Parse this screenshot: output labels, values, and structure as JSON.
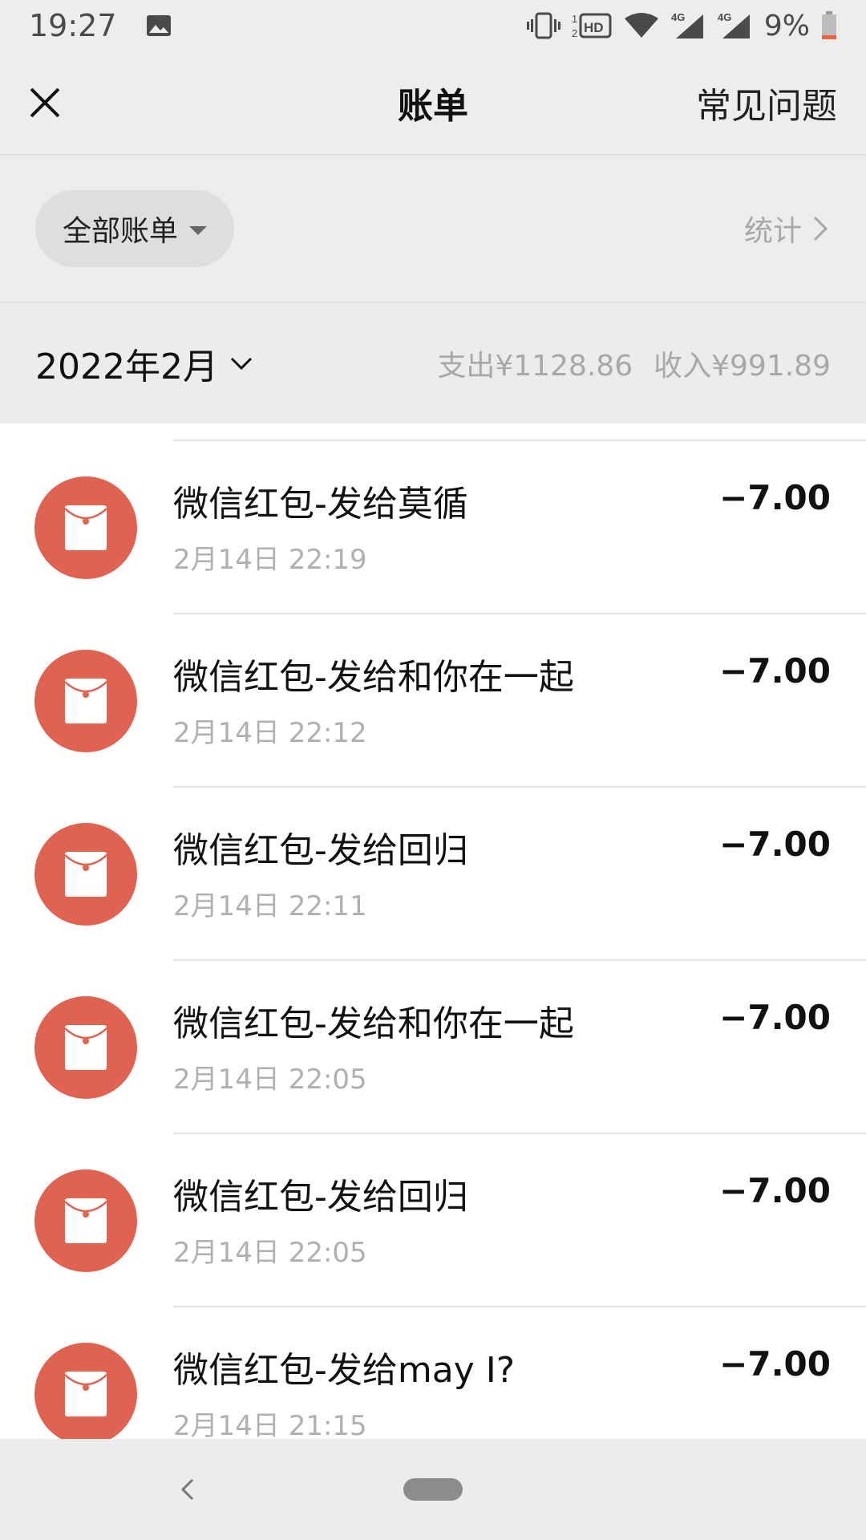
{
  "status_bar": {
    "time": "19:27",
    "icons": [
      "image-icon",
      "vibrate-icon",
      "hd-icon",
      "wifi-icon",
      "signal-4g-icon",
      "signal-4g-icon",
      "battery-icon"
    ],
    "net_label_1": "4G",
    "net_label_2": "4G",
    "battery": "9%"
  },
  "nav": {
    "title": "账单",
    "faq_label": "常见问题"
  },
  "filter": {
    "selected": "全部账单",
    "stats_label": "统计"
  },
  "month": {
    "label": "2022年2月",
    "expense": "支出¥1128.86",
    "income": "收入¥991.89"
  },
  "colors": {
    "accent": "#e06351",
    "background": "#ededed",
    "list_background": "#ffffff",
    "muted_text": "#a8a8a8"
  },
  "transactions": [
    {
      "title": "微信红包-发给莫循",
      "time": "2月14日 22:19",
      "amount": "−7.00",
      "icon": "red-packet-icon"
    },
    {
      "title": "微信红包-发给和你在一起",
      "time": "2月14日 22:12",
      "amount": "−7.00",
      "icon": "red-packet-icon"
    },
    {
      "title": "微信红包-发给回归",
      "time": "2月14日 22:11",
      "amount": "−7.00",
      "icon": "red-packet-icon"
    },
    {
      "title": "微信红包-发给和你在一起",
      "time": "2月14日 22:05",
      "amount": "−7.00",
      "icon": "red-packet-icon"
    },
    {
      "title": "微信红包-发给回归",
      "time": "2月14日 22:05",
      "amount": "−7.00",
      "icon": "red-packet-icon"
    },
    {
      "title": "微信红包-发给may I?",
      "time": "2月14日 21:15",
      "amount": "−7.00",
      "icon": "red-packet-icon"
    }
  ]
}
